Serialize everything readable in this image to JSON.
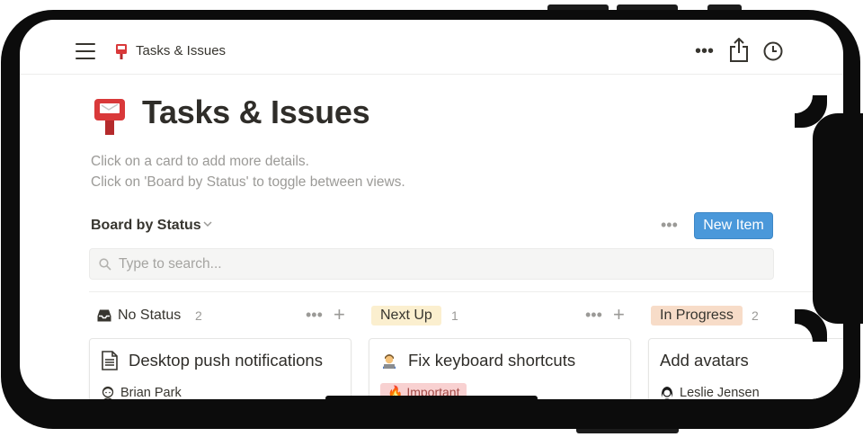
{
  "topbar": {
    "breadcrumb": "Tasks & Issues",
    "menu_icon": "hamburger-icon",
    "more_icon": "more-horizontal-icon",
    "share_icon": "share-icon",
    "history_icon": "clock-icon"
  },
  "page": {
    "icon": "postbox-icon",
    "title": "Tasks & Issues",
    "description": [
      "Click on a card to add more details.",
      "Click on 'Board by Status' to toggle between views."
    ]
  },
  "view": {
    "label": "Board by Status",
    "more_label": "•••",
    "new_item_label": "New Item"
  },
  "search": {
    "placeholder": "Type to search...",
    "value": ""
  },
  "columns": [
    {
      "name": "No Status",
      "count": "2",
      "style": "plain",
      "icon": "inbox-icon",
      "card": {
        "title": "Desktop push notifications",
        "icon": "document-icon",
        "person": "Brian Park",
        "person_icon": "avatar-icon",
        "strip_color": "#dbeddb"
      }
    },
    {
      "name": "Next Up",
      "count": "1",
      "style": "yellow",
      "card": {
        "title": "Fix keyboard shortcuts",
        "icon": "technologist-icon",
        "tag": "🔥 Important"
      }
    },
    {
      "name": "In Progress",
      "count": "2",
      "style": "orange",
      "card": {
        "title": "Add avatars",
        "person": "Leslie Jensen",
        "person_icon": "avatar-icon",
        "strip_color": "#fadec9"
      }
    }
  ],
  "colors": {
    "accent": "#4a98da",
    "tag_yellow": "#fbefcf",
    "tag_orange": "#f7dcc8",
    "tag_red": "#f8d1d1"
  }
}
